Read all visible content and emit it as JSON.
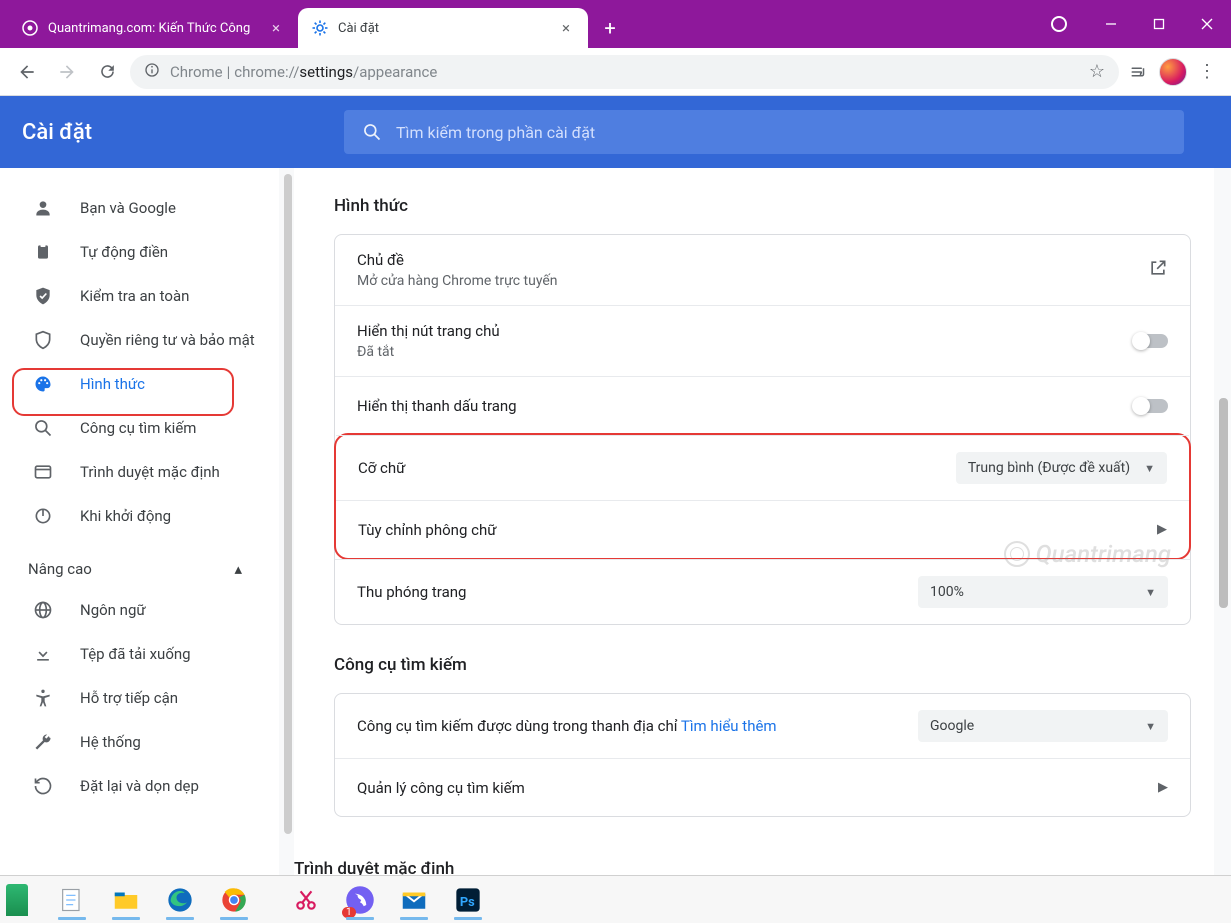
{
  "tabs": {
    "inactive": {
      "title": "Quantrimang.com: Kiến Thức Công"
    },
    "active": {
      "title": "Cài đặt"
    }
  },
  "omnibox": {
    "prefix": "Chrome",
    "sep": " | ",
    "path1": "chrome://",
    "path2": "settings",
    "path3": "/appearance"
  },
  "settings": {
    "title": "Cài đặt",
    "search_placeholder": "Tìm kiếm trong phần cài đặt"
  },
  "sidebar": {
    "items": [
      {
        "label": "Bạn và Google",
        "icon": "person"
      },
      {
        "label": "Tự động điền",
        "icon": "clipboard"
      },
      {
        "label": "Kiểm tra an toàn",
        "icon": "shield-check"
      },
      {
        "label": "Quyền riêng tư và bảo mật",
        "icon": "shield"
      },
      {
        "label": "Hình thức",
        "icon": "palette",
        "active": true
      },
      {
        "label": "Công cụ tìm kiếm",
        "icon": "search"
      },
      {
        "label": "Trình duyệt mặc định",
        "icon": "browser"
      },
      {
        "label": "Khi khởi động",
        "icon": "power"
      }
    ],
    "advanced": "Nâng cao",
    "adv_items": [
      {
        "label": "Ngôn ngữ",
        "icon": "globe"
      },
      {
        "label": "Tệp đã tải xuống",
        "icon": "download"
      },
      {
        "label": "Hỗ trợ tiếp cận",
        "icon": "accessibility"
      },
      {
        "label": "Hệ thống",
        "icon": "wrench"
      },
      {
        "label": "Đặt lại và dọn dẹp",
        "icon": "restore"
      }
    ]
  },
  "appearance": {
    "section": "Hình thức",
    "theme_title": "Chủ đề",
    "theme_sub": "Mở cửa hàng Chrome trực tuyến",
    "home_title": "Hiển thị nút trang chủ",
    "home_sub": "Đã tắt",
    "bookmarks": "Hiển thị thanh dấu trang",
    "font_size_label": "Cỡ chữ",
    "font_size_value": "Trung bình (Được đề xuất)",
    "customize_fonts": "Tùy chỉnh phông chữ",
    "zoom_label": "Thu phóng trang",
    "zoom_value": "100%"
  },
  "search_engine": {
    "section": "Công cụ tìm kiếm",
    "row1a": "Công cụ tìm kiếm được dùng trong thanh địa chỉ ",
    "row1_link": "Tìm hiểu thêm",
    "row1_value": "Google",
    "row2": "Quản lý công cụ tìm kiếm"
  },
  "next_section_peek": "Trình duyệt mặc định",
  "watermark": "Quantrimang"
}
